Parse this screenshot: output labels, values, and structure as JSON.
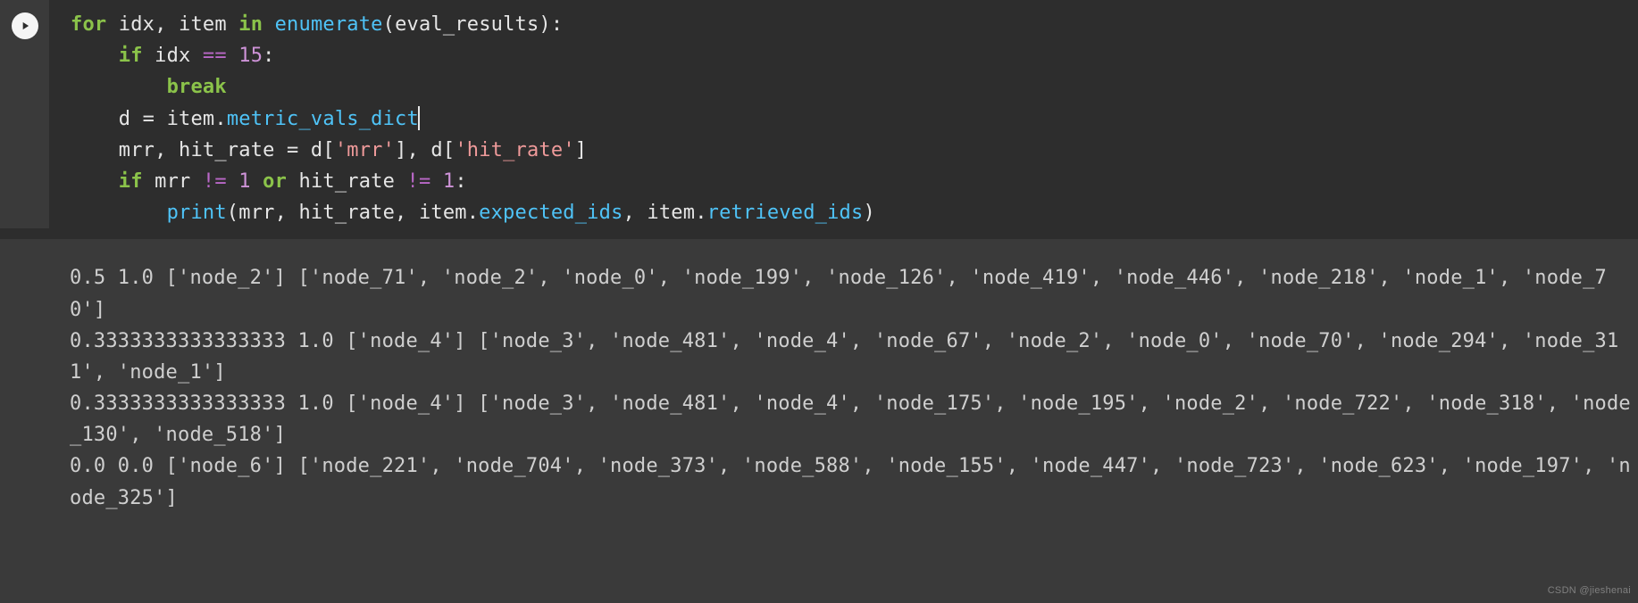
{
  "code": {
    "line1": {
      "for": "for",
      "idx": "idx",
      "comma": ", ",
      "item": "item",
      "in": "in",
      "enumerate": "enumerate",
      "lparen": "(",
      "arg": "eval_results",
      "rparen": "):"
    },
    "line2": {
      "if": "if",
      "idx": "idx",
      "eq": "==",
      "num": "15",
      "colon": ":"
    },
    "line3": {
      "break": "break"
    },
    "line4": {
      "d": "d",
      "assign": " = ",
      "item": "item",
      "dot": ".",
      "attr": "metric_vals_dict"
    },
    "line5": {
      "mrr": "mrr",
      "comma1": ", ",
      "hit_rate": "hit_rate",
      "assign": " = ",
      "d1": "d",
      "lb1": "[",
      "k1": "'mrr'",
      "rb1": "], ",
      "d2": "d",
      "lb2": "[",
      "k2": "'hit_rate'",
      "rb2": "]"
    },
    "line6": {
      "if": "if",
      "mrr": "mrr",
      "neq1": "!=",
      "one1": "1",
      "or": "or",
      "hit_rate": "hit_rate",
      "neq2": "!=",
      "one2": "1",
      "colon": ":"
    },
    "line7": {
      "print": "print",
      "lparen": "(",
      "a1": "mrr",
      "c1": ", ",
      "a2": "hit_rate",
      "c2": ", ",
      "item1": "item",
      "dot1": ".",
      "attr1": "expected_ids",
      "c3": ", ",
      "item2": "item",
      "dot2": ".",
      "attr2": "retrieved_ids",
      "rparen": ")"
    }
  },
  "output_lines": [
    "0.5 1.0 ['node_2'] ['node_71', 'node_2', 'node_0', 'node_199', 'node_126', 'node_419', 'node_446', 'node_218', 'node_1', 'node_70']",
    "0.3333333333333333 1.0 ['node_4'] ['node_3', 'node_481', 'node_4', 'node_67', 'node_2', 'node_0', 'node_70', 'node_294', 'node_311', 'node_1']",
    "0.3333333333333333 1.0 ['node_4'] ['node_3', 'node_481', 'node_4', 'node_175', 'node_195', 'node_2', 'node_722', 'node_318', 'node_130', 'node_518']",
    "0.0 0.0 ['node_6'] ['node_221', 'node_704', 'node_373', 'node_588', 'node_155', 'node_447', 'node_723', 'node_623', 'node_197', 'node_325']"
  ],
  "watermark": "CSDN @jieshenai"
}
